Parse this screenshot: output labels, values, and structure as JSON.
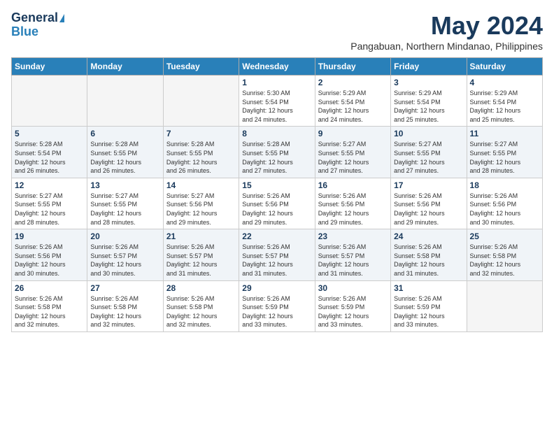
{
  "logo": {
    "line1": "General",
    "line2": "Blue"
  },
  "title": "May 2024",
  "location": "Pangabuan, Northern Mindanao, Philippines",
  "days_header": [
    "Sunday",
    "Monday",
    "Tuesday",
    "Wednesday",
    "Thursday",
    "Friday",
    "Saturday"
  ],
  "weeks": [
    [
      {
        "day": "",
        "info": ""
      },
      {
        "day": "",
        "info": ""
      },
      {
        "day": "",
        "info": ""
      },
      {
        "day": "1",
        "info": "Sunrise: 5:30 AM\nSunset: 5:54 PM\nDaylight: 12 hours\nand 24 minutes."
      },
      {
        "day": "2",
        "info": "Sunrise: 5:29 AM\nSunset: 5:54 PM\nDaylight: 12 hours\nand 24 minutes."
      },
      {
        "day": "3",
        "info": "Sunrise: 5:29 AM\nSunset: 5:54 PM\nDaylight: 12 hours\nand 25 minutes."
      },
      {
        "day": "4",
        "info": "Sunrise: 5:29 AM\nSunset: 5:54 PM\nDaylight: 12 hours\nand 25 minutes."
      }
    ],
    [
      {
        "day": "5",
        "info": "Sunrise: 5:28 AM\nSunset: 5:54 PM\nDaylight: 12 hours\nand 26 minutes."
      },
      {
        "day": "6",
        "info": "Sunrise: 5:28 AM\nSunset: 5:55 PM\nDaylight: 12 hours\nand 26 minutes."
      },
      {
        "day": "7",
        "info": "Sunrise: 5:28 AM\nSunset: 5:55 PM\nDaylight: 12 hours\nand 26 minutes."
      },
      {
        "day": "8",
        "info": "Sunrise: 5:28 AM\nSunset: 5:55 PM\nDaylight: 12 hours\nand 27 minutes."
      },
      {
        "day": "9",
        "info": "Sunrise: 5:27 AM\nSunset: 5:55 PM\nDaylight: 12 hours\nand 27 minutes."
      },
      {
        "day": "10",
        "info": "Sunrise: 5:27 AM\nSunset: 5:55 PM\nDaylight: 12 hours\nand 27 minutes."
      },
      {
        "day": "11",
        "info": "Sunrise: 5:27 AM\nSunset: 5:55 PM\nDaylight: 12 hours\nand 28 minutes."
      }
    ],
    [
      {
        "day": "12",
        "info": "Sunrise: 5:27 AM\nSunset: 5:55 PM\nDaylight: 12 hours\nand 28 minutes."
      },
      {
        "day": "13",
        "info": "Sunrise: 5:27 AM\nSunset: 5:55 PM\nDaylight: 12 hours\nand 28 minutes."
      },
      {
        "day": "14",
        "info": "Sunrise: 5:27 AM\nSunset: 5:56 PM\nDaylight: 12 hours\nand 29 minutes."
      },
      {
        "day": "15",
        "info": "Sunrise: 5:26 AM\nSunset: 5:56 PM\nDaylight: 12 hours\nand 29 minutes."
      },
      {
        "day": "16",
        "info": "Sunrise: 5:26 AM\nSunset: 5:56 PM\nDaylight: 12 hours\nand 29 minutes."
      },
      {
        "day": "17",
        "info": "Sunrise: 5:26 AM\nSunset: 5:56 PM\nDaylight: 12 hours\nand 29 minutes."
      },
      {
        "day": "18",
        "info": "Sunrise: 5:26 AM\nSunset: 5:56 PM\nDaylight: 12 hours\nand 30 minutes."
      }
    ],
    [
      {
        "day": "19",
        "info": "Sunrise: 5:26 AM\nSunset: 5:56 PM\nDaylight: 12 hours\nand 30 minutes."
      },
      {
        "day": "20",
        "info": "Sunrise: 5:26 AM\nSunset: 5:57 PM\nDaylight: 12 hours\nand 30 minutes."
      },
      {
        "day": "21",
        "info": "Sunrise: 5:26 AM\nSunset: 5:57 PM\nDaylight: 12 hours\nand 31 minutes."
      },
      {
        "day": "22",
        "info": "Sunrise: 5:26 AM\nSunset: 5:57 PM\nDaylight: 12 hours\nand 31 minutes."
      },
      {
        "day": "23",
        "info": "Sunrise: 5:26 AM\nSunset: 5:57 PM\nDaylight: 12 hours\nand 31 minutes."
      },
      {
        "day": "24",
        "info": "Sunrise: 5:26 AM\nSunset: 5:58 PM\nDaylight: 12 hours\nand 31 minutes."
      },
      {
        "day": "25",
        "info": "Sunrise: 5:26 AM\nSunset: 5:58 PM\nDaylight: 12 hours\nand 32 minutes."
      }
    ],
    [
      {
        "day": "26",
        "info": "Sunrise: 5:26 AM\nSunset: 5:58 PM\nDaylight: 12 hours\nand 32 minutes."
      },
      {
        "day": "27",
        "info": "Sunrise: 5:26 AM\nSunset: 5:58 PM\nDaylight: 12 hours\nand 32 minutes."
      },
      {
        "day": "28",
        "info": "Sunrise: 5:26 AM\nSunset: 5:58 PM\nDaylight: 12 hours\nand 32 minutes."
      },
      {
        "day": "29",
        "info": "Sunrise: 5:26 AM\nSunset: 5:59 PM\nDaylight: 12 hours\nand 33 minutes."
      },
      {
        "day": "30",
        "info": "Sunrise: 5:26 AM\nSunset: 5:59 PM\nDaylight: 12 hours\nand 33 minutes."
      },
      {
        "day": "31",
        "info": "Sunrise: 5:26 AM\nSunset: 5:59 PM\nDaylight: 12 hours\nand 33 minutes."
      },
      {
        "day": "",
        "info": ""
      }
    ]
  ]
}
